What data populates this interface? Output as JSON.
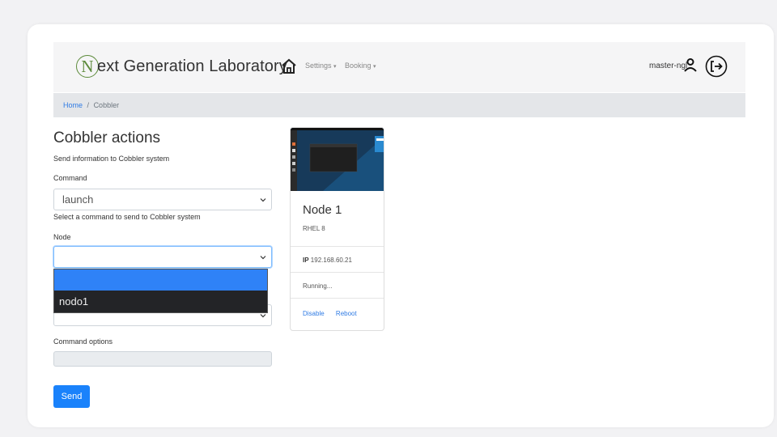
{
  "navbar": {
    "brand_initial": "N",
    "brand_text": "ext Generation Laboratory",
    "menus": [
      {
        "label": "Settings"
      },
      {
        "label": "Booking"
      }
    ],
    "username": "master-ngl"
  },
  "breadcrumb": {
    "home": "Home",
    "separator": "/",
    "current": "Cobbler"
  },
  "form": {
    "title": "Cobbler actions",
    "subtitle": "Send information to Cobbler system",
    "command_label": "Command",
    "command_value": "launch",
    "command_help": "Select a command to send to Cobbler system",
    "node_label": "Node",
    "node_value": "",
    "node_options": [
      "",
      "nodo1"
    ],
    "options_label": "Command options",
    "send_label": "Send"
  },
  "node_card": {
    "name": "Node 1",
    "os": "RHEL 8",
    "ip_label": "IP",
    "ip": "192.168.60.21",
    "status": "Running...",
    "actions": [
      "Disable",
      "Reboot"
    ]
  },
  "colors": {
    "accent": "#1a82fb",
    "link": "#2f7be4",
    "brand": "#5c8a3a"
  }
}
